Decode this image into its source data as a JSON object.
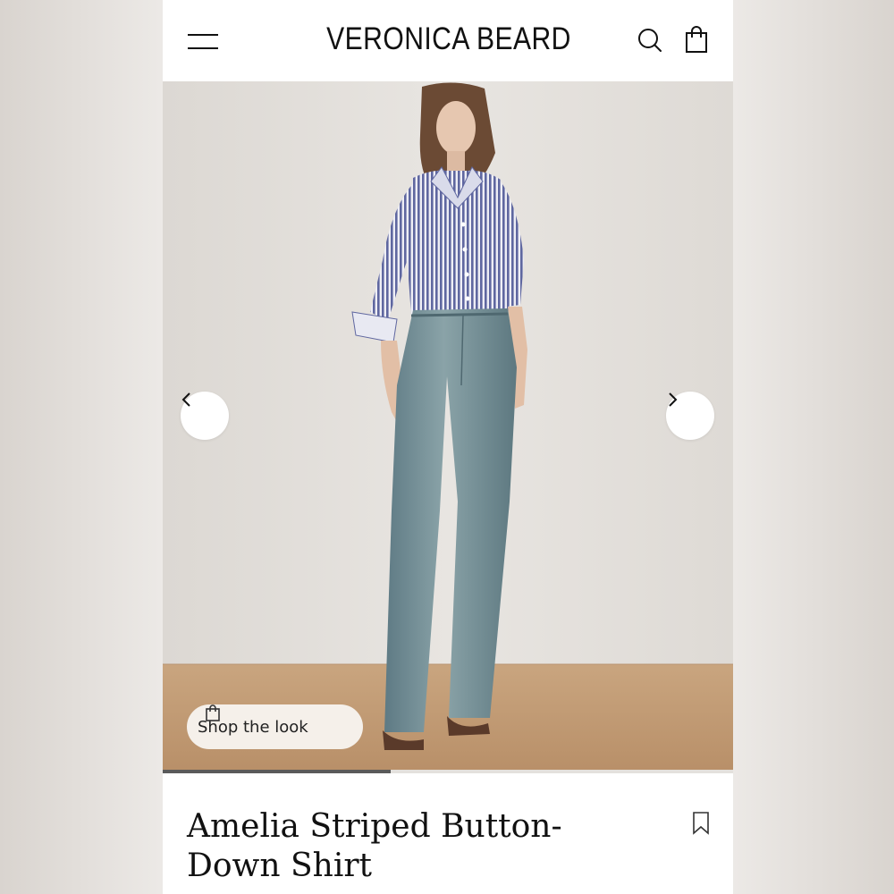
{
  "header": {
    "brand": "VERONICA BEARD",
    "menu_icon": "hamburger-icon",
    "search_icon": "search-icon",
    "bag_icon": "shopping-bag-icon"
  },
  "hero": {
    "image_icon": "product-photo",
    "prev_icon": "chevron-left-icon",
    "next_icon": "chevron-right-icon",
    "shop_the_look_label": "Shop the look",
    "carousel_progress": 0.4
  },
  "product": {
    "title": "Amelia Striped Button-Down Shirt",
    "save_icon": "bookmark-icon"
  },
  "colors": {
    "wall": "#e3e0dc",
    "floor": "#c49f78",
    "shirt": "#7f86ab",
    "denim": "#6e8a92"
  }
}
